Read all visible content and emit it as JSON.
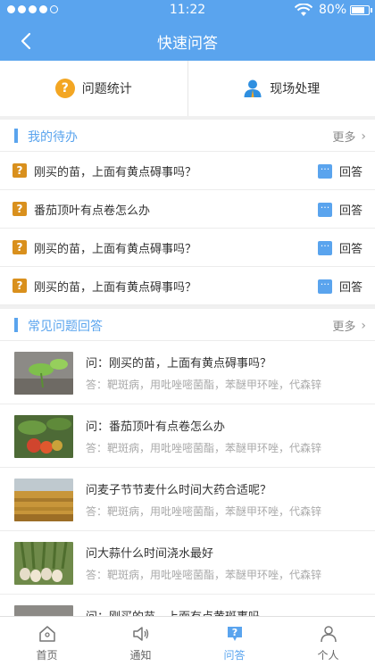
{
  "status": {
    "time": "11:22",
    "battery": "80%"
  },
  "nav": {
    "title": "快速问答"
  },
  "quick": [
    {
      "label": "问题统计",
      "icon": "question-circle-icon"
    },
    {
      "label": "现场处理",
      "icon": "person-icon"
    }
  ],
  "todo": {
    "title": "我的待办",
    "more": "更多",
    "items": [
      {
        "text": "刚买的苗，上面有黄点碍事吗？",
        "action": "回答"
      },
      {
        "text": "番茄顶叶有点卷怎么办",
        "action": "回答"
      },
      {
        "text": "刚买的苗，上面有黄点碍事吗？",
        "action": "回答"
      },
      {
        "text": "刚买的苗，上面有黄点碍事吗？",
        "action": "回答"
      }
    ]
  },
  "faq": {
    "title": "常见问题回答",
    "more": "更多",
    "items": [
      {
        "q": "问：刚买的苗，上面有黄点碍事吗？",
        "a": "答：靶斑病，用吡唑嘧菌酯，苯醚甲环唑，代森锌",
        "thumb": "seedling"
      },
      {
        "q": "问：番茄顶叶有点卷怎么办",
        "a": "答：靶斑病，用吡唑嘧菌酯，苯醚甲环唑，代森锌",
        "thumb": "tomato"
      },
      {
        "q": "问麦子节节麦什么时间大药合适呢？",
        "a": "答：靶斑病，用吡唑嘧菌酯，苯醚甲环唑，代森锌",
        "thumb": "wheat"
      },
      {
        "q": "问大蒜什么时间浇水最好",
        "a": "答：靶斑病，用吡唑嘧菌酯，苯醚甲环唑，代森锌",
        "thumb": "garlic"
      },
      {
        "q": "问：刚买的苗，上面有点黄斑事吗",
        "a": "",
        "thumb": "seedling"
      }
    ]
  },
  "tabs": [
    {
      "label": "首页",
      "icon": "home-icon",
      "active": false
    },
    {
      "label": "通知",
      "icon": "speaker-icon",
      "active": false
    },
    {
      "label": "问答",
      "icon": "qa-icon",
      "active": true
    },
    {
      "label": "个人",
      "icon": "user-icon",
      "active": false
    }
  ],
  "colors": {
    "accent": "#5aa4ee",
    "question_badge": "#d9901d"
  }
}
